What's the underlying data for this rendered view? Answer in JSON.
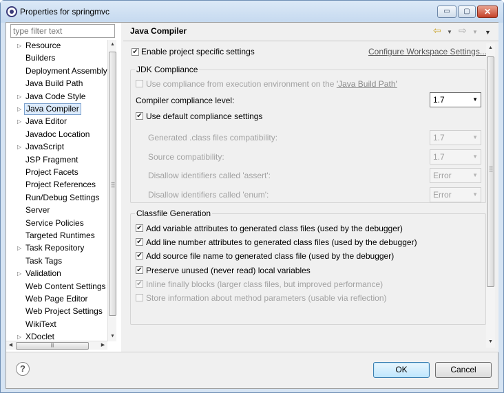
{
  "window": {
    "title": "Properties for springmvc",
    "minimize": "▭",
    "maximize": "▢",
    "close": "✕"
  },
  "sidebar": {
    "filter_placeholder": "type filter text",
    "items": [
      {
        "label": "Resource",
        "expandable": true
      },
      {
        "label": "Builders",
        "expandable": false
      },
      {
        "label": "Deployment Assembly",
        "expandable": false
      },
      {
        "label": "Java Build Path",
        "expandable": false
      },
      {
        "label": "Java Code Style",
        "expandable": true
      },
      {
        "label": "Java Compiler",
        "expandable": true,
        "selected": true
      },
      {
        "label": "Java Editor",
        "expandable": true
      },
      {
        "label": "Javadoc Location",
        "expandable": false
      },
      {
        "label": "JavaScript",
        "expandable": true
      },
      {
        "label": "JSP Fragment",
        "expandable": false
      },
      {
        "label": "Project Facets",
        "expandable": false
      },
      {
        "label": "Project References",
        "expandable": false
      },
      {
        "label": "Run/Debug Settings",
        "expandable": false
      },
      {
        "label": "Server",
        "expandable": false
      },
      {
        "label": "Service Policies",
        "expandable": false
      },
      {
        "label": "Targeted Runtimes",
        "expandable": false
      },
      {
        "label": "Task Repository",
        "expandable": true
      },
      {
        "label": "Task Tags",
        "expandable": false
      },
      {
        "label": "Validation",
        "expandable": true
      },
      {
        "label": "Web Content Settings",
        "expandable": false
      },
      {
        "label": "Web Page Editor",
        "expandable": false
      },
      {
        "label": "Web Project Settings",
        "expandable": false
      },
      {
        "label": "WikiText",
        "expandable": false
      },
      {
        "label": "XDoclet",
        "expandable": true
      }
    ]
  },
  "page": {
    "title": "Java Compiler",
    "enable_specific": {
      "label": "Enable project specific settings",
      "checked": true
    },
    "configure_link": "Configure Workspace Settings...",
    "jdk": {
      "group_title": "JDK Compliance",
      "use_env_label": "Use compliance from execution environment on the ",
      "use_env_link": "'Java Build Path'",
      "compliance_label": "Compiler compliance level:",
      "compliance_value": "1.7",
      "use_default_label": "Use default compliance settings",
      "rows": [
        {
          "label": "Generated .class files compatibility:",
          "value": "1.7"
        },
        {
          "label": "Source compatibility:",
          "value": "1.7"
        },
        {
          "label": "Disallow identifiers called 'assert':",
          "value": "Error"
        },
        {
          "label": "Disallow identifiers called 'enum':",
          "value": "Error"
        }
      ]
    },
    "classfile": {
      "group_title": "Classfile Generation",
      "options": [
        {
          "label": "Add variable attributes to generated class files (used by the debugger)",
          "checked": true,
          "enabled": true
        },
        {
          "label": "Add line number attributes to generated class files (used by the debugger)",
          "checked": true,
          "enabled": true
        },
        {
          "label": "Add source file name to generated class file (used by the debugger)",
          "checked": true,
          "enabled": true
        },
        {
          "label": "Preserve unused (never read) local variables",
          "checked": true,
          "enabled": true
        },
        {
          "label": "Inline finally blocks (larger class files, but improved performance)",
          "checked": true,
          "enabled": false
        },
        {
          "label": "Store information about method parameters (usable via reflection)",
          "checked": false,
          "enabled": false
        }
      ]
    }
  },
  "footer": {
    "help": "?",
    "ok": "OK",
    "cancel": "Cancel"
  }
}
